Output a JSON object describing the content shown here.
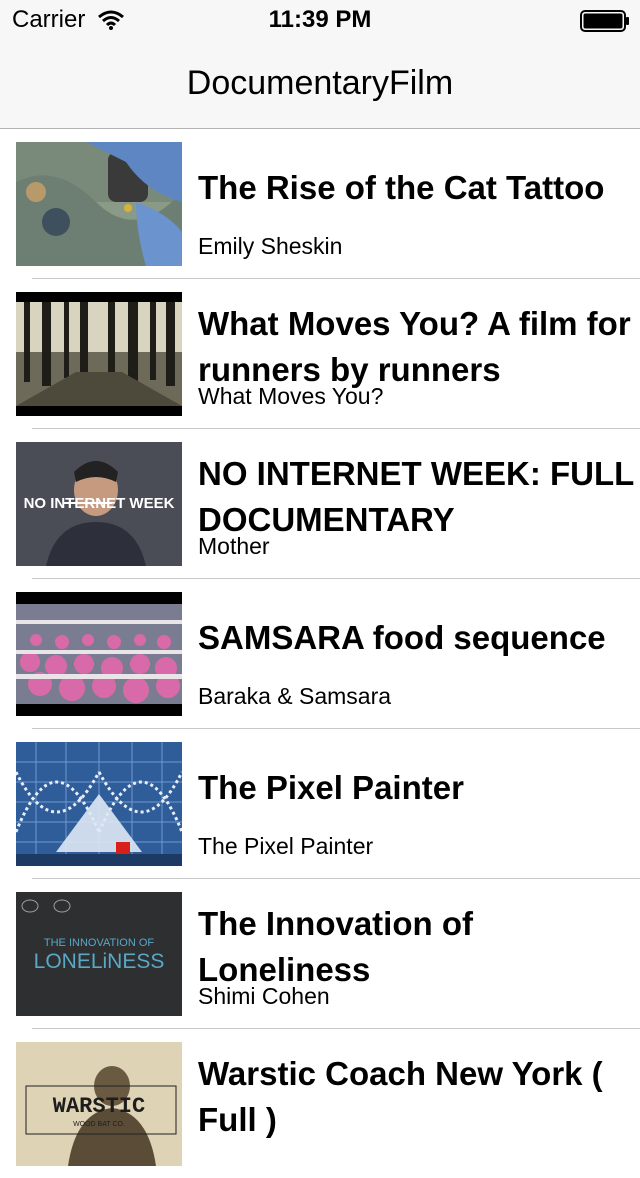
{
  "status_bar": {
    "carrier": "Carrier",
    "time": "11:39 PM"
  },
  "nav": {
    "title": "DocumentaryFilm"
  },
  "films": [
    {
      "title": "The Rise of the Cat Tattoo",
      "author": "Emily Sheskin",
      "thumb": "tattoo"
    },
    {
      "title": "What Moves You? A film for runners by runners",
      "author": "What Moves You?",
      "thumb": "forest"
    },
    {
      "title": "NO INTERNET WEEK: FULL DOCUMENTARY",
      "author": "Mother",
      "thumb": "person",
      "thumb_text": "NO INTERNET WEEK"
    },
    {
      "title": "SAMSARA food sequence",
      "author": "Baraka & Samsara",
      "thumb": "factory"
    },
    {
      "title": "The Pixel Painter",
      "author": "The Pixel Painter",
      "thumb": "pixel"
    },
    {
      "title": "The Innovation of Loneliness",
      "author": "Shimi Cohen",
      "thumb": "loneliness",
      "thumb_text_1": "THE INNOVATION OF",
      "thumb_text_2": "LONELiNESS"
    },
    {
      "title": "Warstic Coach New York ( Full )",
      "author": "",
      "thumb": "warstic",
      "thumb_text_1": "WARSTIC",
      "thumb_text_2": "WOOD BAT CO."
    }
  ]
}
